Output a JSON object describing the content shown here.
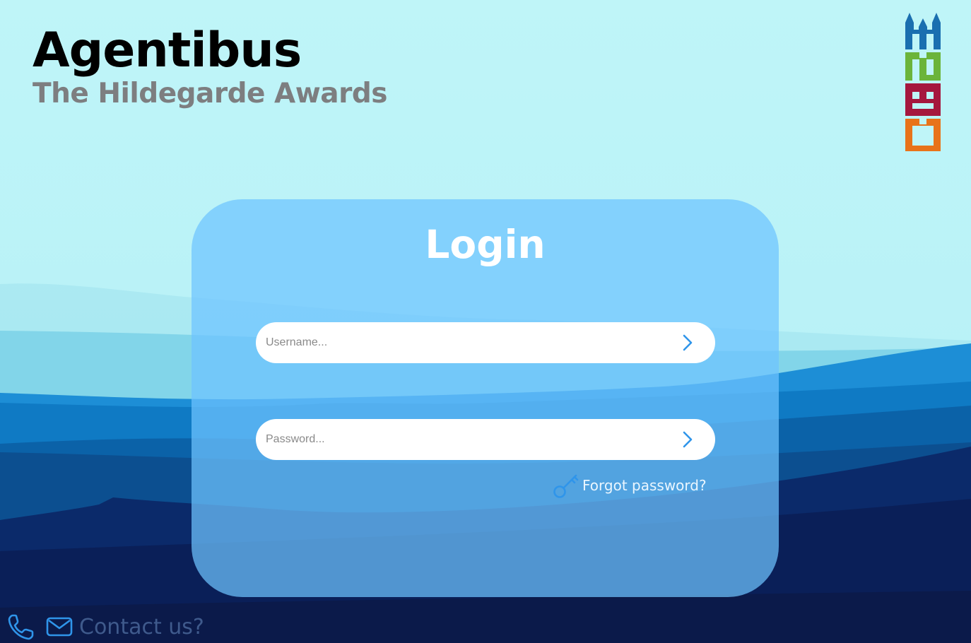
{
  "brand": {
    "title": "Agentibus",
    "subtitle": "The Hildegarde Awards"
  },
  "logo": {
    "icon": "tower-stack-logo",
    "colors": [
      "#1a6fb0",
      "#6bb43a",
      "#a5173e",
      "#e8731a"
    ]
  },
  "login": {
    "title": "Login",
    "username_placeholder": "Username...",
    "password_placeholder": "Password...",
    "submit_icon": "chevron-right-icon",
    "forgot_label": "Forgot password?",
    "forgot_icon": "key-icon"
  },
  "footer": {
    "phone_icon": "phone-icon",
    "mail_icon": "mail-icon",
    "contact_label": "Contact us?"
  },
  "colors": {
    "sky": "#bff5f8",
    "accent": "#3aa0f0",
    "card": "#6ec4ff",
    "deep_navy": "#0b1a4a"
  }
}
